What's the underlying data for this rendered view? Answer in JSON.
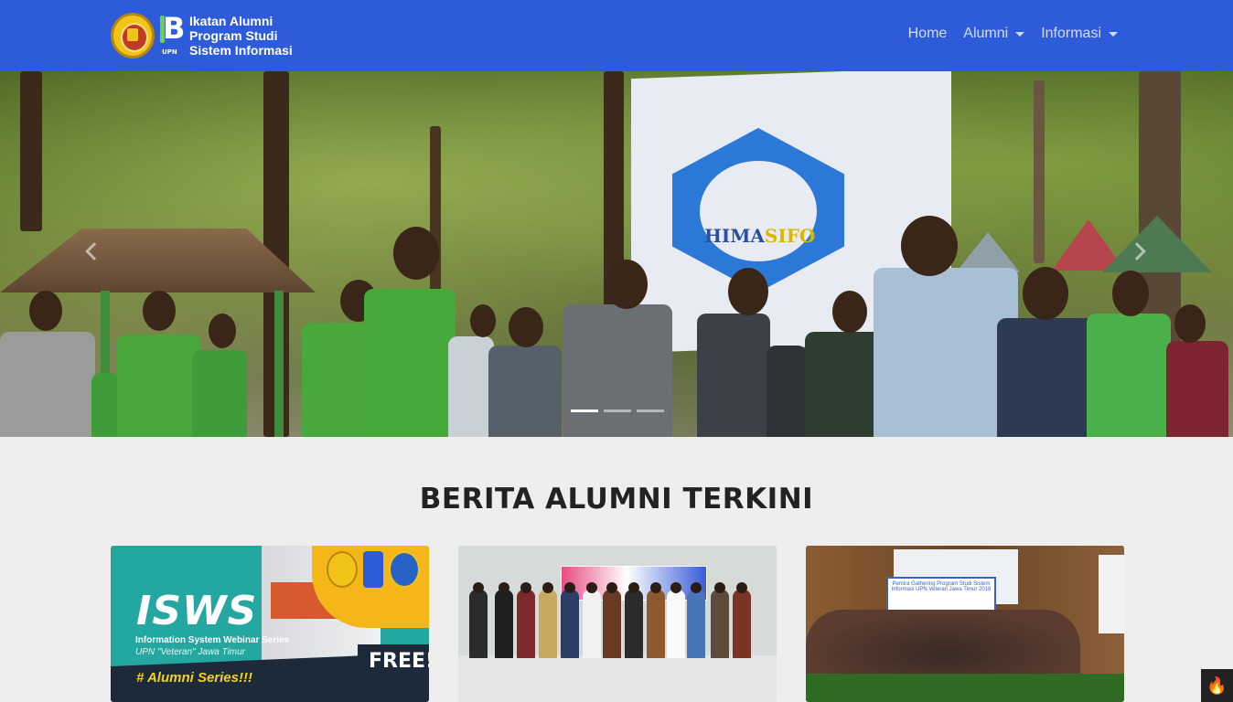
{
  "navbar": {
    "brand_line1": "Ikatan Alumni",
    "brand_line2": "Program Studi",
    "brand_line3": "Sistem Informasi",
    "logo_b_text": "B",
    "logo_b_sub": "UPN",
    "menu": [
      {
        "label": "Home",
        "dropdown": false
      },
      {
        "label": "Alumni",
        "dropdown": true
      },
      {
        "label": "Informasi",
        "dropdown": true
      }
    ]
  },
  "hero": {
    "banner_title": "HIMA",
    "banner_title_accent": "SIFO",
    "indicators": 3,
    "active_indicator": 1
  },
  "section": {
    "title": "BERITA ALUMNI TERKINI"
  },
  "cards": [
    {
      "isws": "ISWS",
      "subtitle": "Information System Webinar Series",
      "subtitle2": "UPN \"Veteran\" Jawa Timur",
      "tag": "# Alumni Series!!!",
      "free": "FREE!"
    },
    {},
    {
      "banner_text": "Pemira Gathering Program Studi Sistem Informasi UPN Veteran Jawa Timur 2018"
    }
  ],
  "colors": {
    "navbar": "#2e5bd9",
    "background": "#eeeeee",
    "title": "#222222"
  },
  "fab": {
    "icon": "fire-icon"
  }
}
